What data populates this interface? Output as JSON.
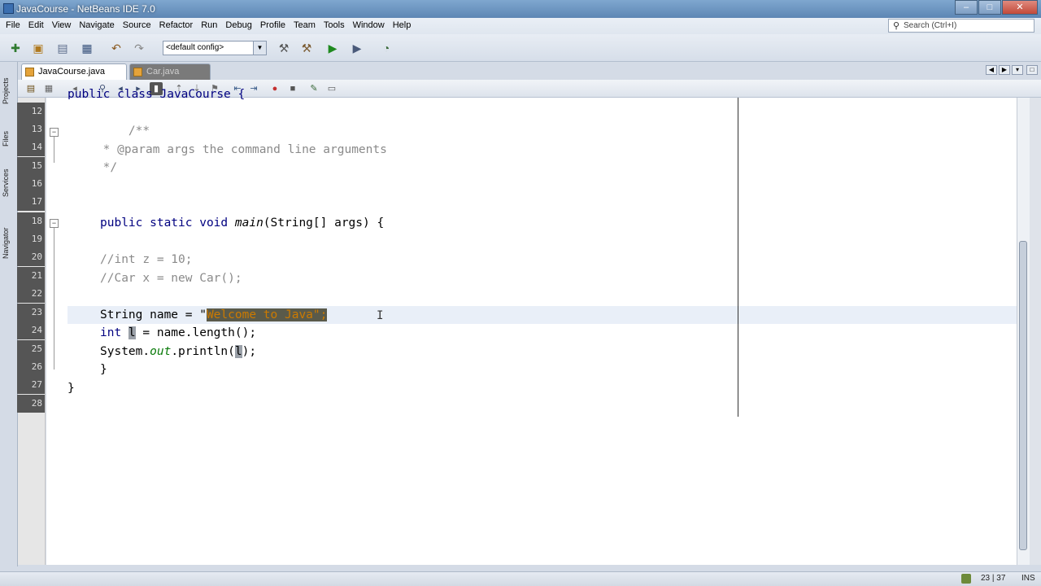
{
  "window": {
    "title": "JavaCourse - NetBeans IDE 7.0",
    "min": "–",
    "max": "□",
    "close": "✕"
  },
  "menu": [
    "File",
    "Edit",
    "View",
    "Navigate",
    "Source",
    "Refactor",
    "Run",
    "Debug",
    "Profile",
    "Team",
    "Tools",
    "Window",
    "Help"
  ],
  "search": {
    "placeholder": "Search (Ctrl+I)",
    "icon": "magnifier-icon"
  },
  "toolbar": {
    "config": "<default config>"
  },
  "left_rail": [
    "Projects",
    "Files",
    "Services",
    "Navigator"
  ],
  "tabs": [
    {
      "label": "JavaCourse.java",
      "active": true
    },
    {
      "label": "Car.java",
      "active": false
    }
  ],
  "editor": {
    "line_numbers": [
      "12",
      "13",
      "14",
      "15",
      "16",
      "17",
      "18",
      "19",
      "20",
      "21",
      "22",
      "23",
      "24",
      "25",
      "26",
      "27",
      "28"
    ],
    "lines": {
      "l11": "public class JavaCourse {",
      "l13": "    /**",
      "l14": "     * @param args the command line arguments",
      "l15": "     */",
      "l18_kw": "public static void ",
      "l18_m": "main",
      "l18_rest": "(String[] args) {",
      "l20": "//int z = 10;",
      "l21": "//Car x = new Car();",
      "l23_a": "String name = \"",
      "l23_sel": "Welcome to Java\";",
      "l24_kw": "int ",
      "l24_v": "l",
      "l24_rest": " = name.length();",
      "l25_a": "System.",
      "l25_out": "out",
      "l25_b": ".println(",
      "l25_v": "l",
      "l25_c": ");",
      "l26": "}",
      "l27": "}"
    }
  },
  "status": {
    "position": "23 | 37",
    "mode": "INS"
  }
}
